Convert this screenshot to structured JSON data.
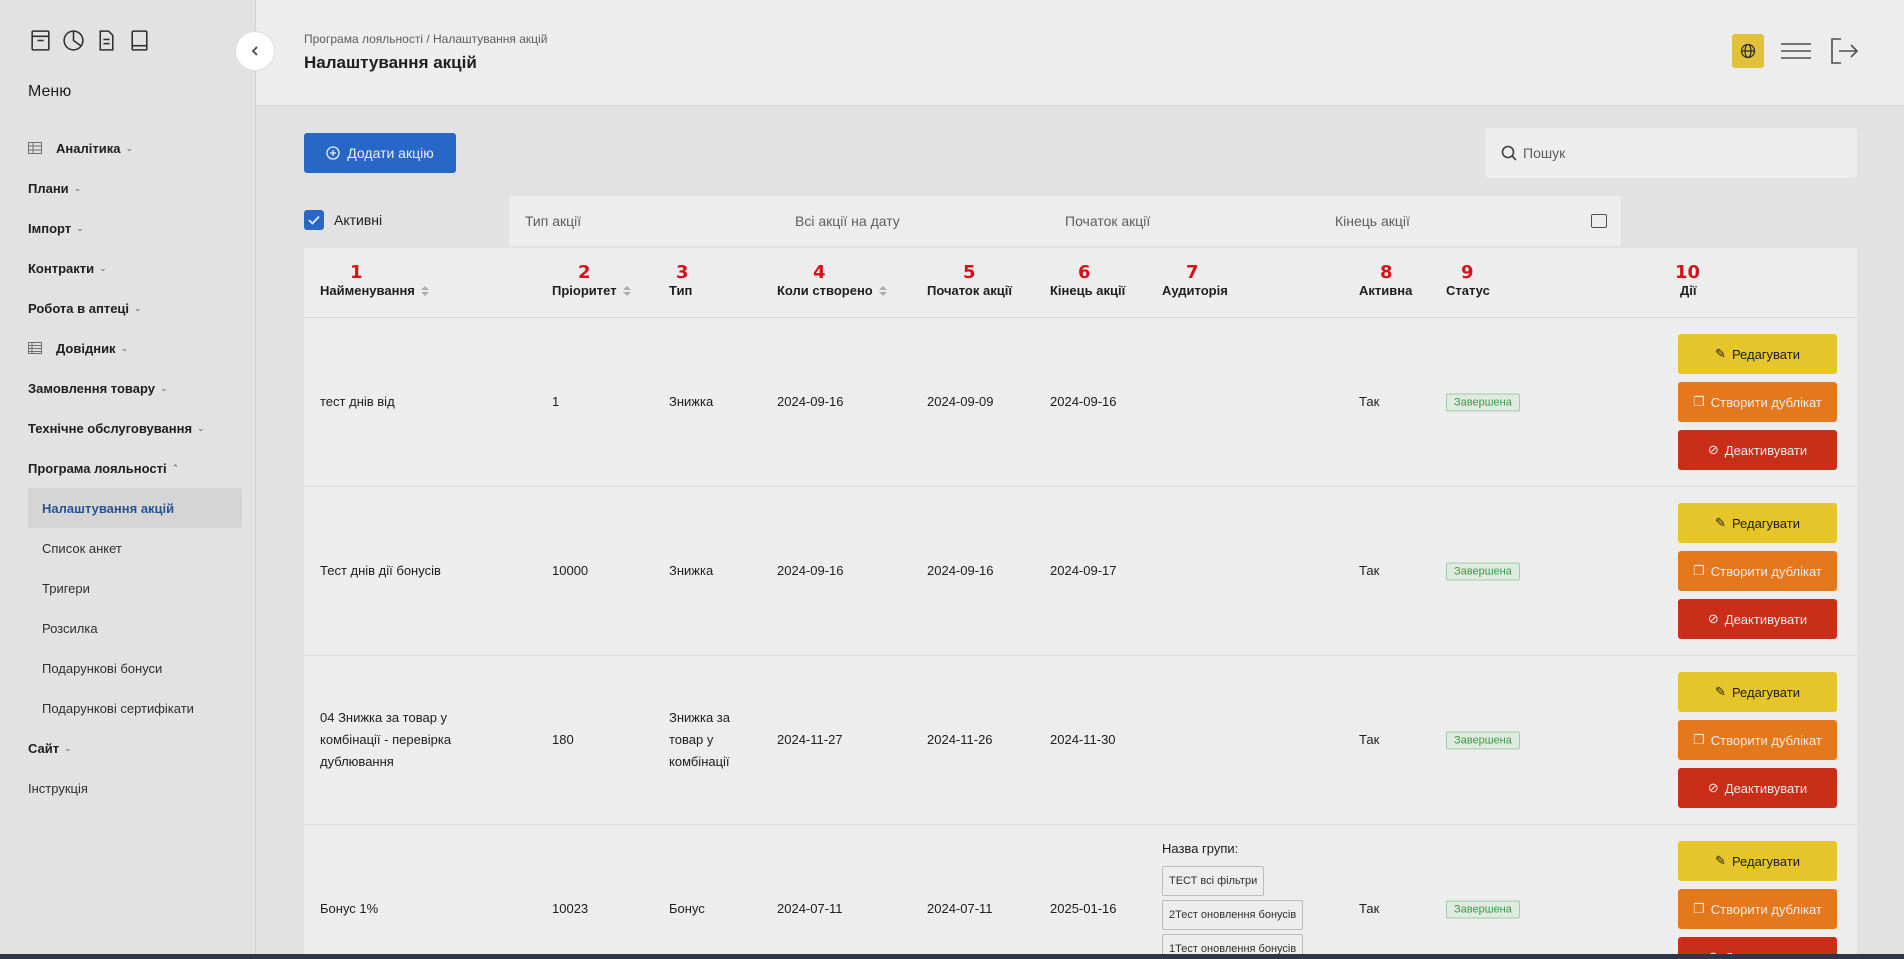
{
  "sidebar": {
    "top_icons": [
      "archive-icon",
      "pie-chart-icon",
      "document-icon",
      "book-icon"
    ],
    "menu_title": "Меню",
    "items": [
      {
        "label": "Аналітика",
        "icon": "table-icon"
      },
      {
        "label": "Плани"
      },
      {
        "label": "Імпорт"
      },
      {
        "label": "Контракти"
      },
      {
        "label": "Робота в аптеці"
      },
      {
        "label": "Довідник",
        "icon": "list-icon"
      },
      {
        "label": "Замовлення товару"
      },
      {
        "label": "Технічне обслуговування"
      },
      {
        "label": "Програма лояльності"
      }
    ],
    "sub_items": [
      {
        "label": "Налаштування акцій"
      },
      {
        "label": "Список анкет"
      },
      {
        "label": "Тригери"
      },
      {
        "label": "Розсилка"
      },
      {
        "label": "Подарункові бонуси"
      },
      {
        "label": "Подарункові сертифікати"
      }
    ],
    "after_items": [
      {
        "label": "Сайт"
      }
    ],
    "plain_items": [
      {
        "label": "Інструкція"
      }
    ]
  },
  "header": {
    "breadcrumb": "Програма лояльності / Налаштування акцій",
    "title": "Налаштування акцій"
  },
  "toolbar": {
    "add_label": "Додати акцію",
    "search_placeholder": "Пошук"
  },
  "filters": {
    "active_label": "Активні",
    "type_placeholder": "Тип акції",
    "date_placeholder": "Всі акції на дату",
    "start_placeholder": "Початок акції",
    "end_placeholder": "Кінець акції"
  },
  "table": {
    "columns": [
      {
        "num": "1",
        "label": "Найменування"
      },
      {
        "num": "2",
        "label": "Пріоритет"
      },
      {
        "num": "3",
        "label": "Тип"
      },
      {
        "num": "4",
        "label": "Коли створено"
      },
      {
        "num": "5",
        "label": "Початок акції"
      },
      {
        "num": "6",
        "label": "Кінець акції"
      },
      {
        "num": "7",
        "label": "Аудиторія"
      },
      {
        "num": "8",
        "label": "Активна"
      },
      {
        "num": "9",
        "label": "Статус"
      },
      {
        "num": "10",
        "label": "Дії"
      }
    ],
    "rows": [
      {
        "name": "тест днів від",
        "priority": "1",
        "type": "Знижка",
        "created": "2024-09-16",
        "start": "2024-09-09",
        "end": "2024-09-16",
        "active": "Так",
        "status": "Завершена"
      },
      {
        "name": "Тест днів дії бонусів",
        "priority": "10000",
        "type": "Знижка",
        "created": "2024-09-16",
        "start": "2024-09-16",
        "end": "2024-09-17",
        "active": "Так",
        "status": "Завершена"
      },
      {
        "name": "04 Знижка за товар у комбінації - перевірка дублювання",
        "priority": "180",
        "type": "Знижка за товар у комбінації",
        "created": "2024-11-27",
        "start": "2024-11-26",
        "end": "2024-11-30",
        "active": "Так",
        "status": "Завершена"
      },
      {
        "name": "Бонус 1%",
        "priority": "10023",
        "type": "Бонус",
        "created": "2024-07-11",
        "start": "2024-07-11",
        "end": "2025-01-16",
        "active": "Так",
        "status": "Завершена",
        "audience_label": "Назва групи:",
        "audience_tags": [
          "ТЕСТ всі фільтри",
          "2Тест оновлення бонусів",
          "1Тест оновлення бонусів"
        ]
      }
    ],
    "actions": {
      "edit": "Редагувати",
      "duplicate": "Створити дублікат",
      "deactivate": "Деактивувати"
    }
  },
  "colors": {
    "primary": "#2b6fd8",
    "edit": "#f7d42e",
    "duplicate": "#f5821f",
    "deactivate": "#d9331a",
    "status": "#3ba94a",
    "annotation": "#e4141b"
  }
}
